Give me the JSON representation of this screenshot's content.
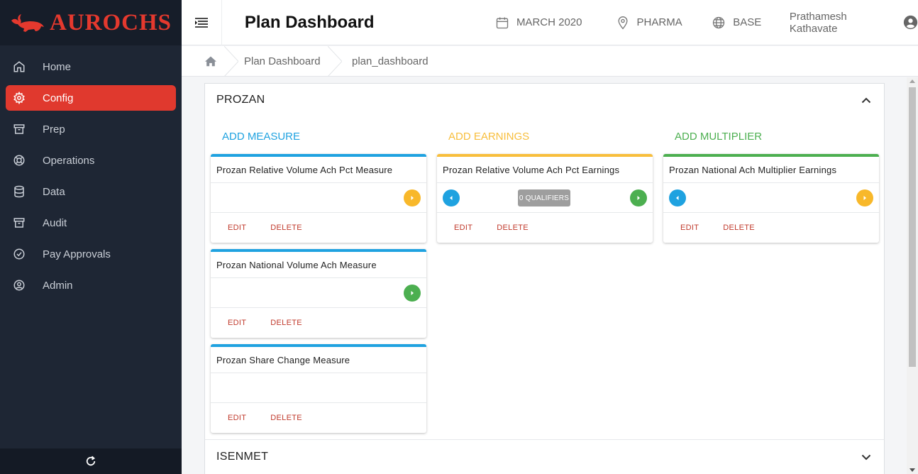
{
  "app": {
    "brand": "AUROCHS",
    "brand_color": "#e0392e"
  },
  "sidebar": {
    "items": [
      {
        "label": "Home",
        "icon": "home-icon",
        "active": false
      },
      {
        "label": "Config",
        "icon": "gear-icon",
        "active": true
      },
      {
        "label": "Prep",
        "icon": "archive-icon",
        "active": false
      },
      {
        "label": "Operations",
        "icon": "lifebuoy-icon",
        "active": false
      },
      {
        "label": "Data",
        "icon": "database-icon",
        "active": false
      },
      {
        "label": "Audit",
        "icon": "archive-icon",
        "active": false
      },
      {
        "label": "Pay Approvals",
        "icon": "check-circle-icon",
        "active": false
      },
      {
        "label": "Admin",
        "icon": "user-circle-icon",
        "active": false
      }
    ],
    "footer_icon": "refresh-icon"
  },
  "header": {
    "title": "Plan Dashboard",
    "period": "MARCH 2020",
    "region": "PHARMA",
    "scenario": "BASE",
    "user": "Prathamesh Kathavate"
  },
  "breadcrumb": {
    "items": [
      "Plan Dashboard",
      "plan_dashboard"
    ]
  },
  "panels": [
    {
      "title": "PROZAN",
      "expanded": true,
      "columns": [
        {
          "add_label": "ADD MEASURE",
          "color": "#1fa2e0",
          "cards": [
            {
              "title": "Prozan Relative Volume Ach Pct Measure",
              "left": null,
              "right": "#f8b82a",
              "badge": null
            },
            {
              "title": "Prozan National Volume Ach Measure",
              "left": null,
              "right": "#4caf50",
              "badge": null
            },
            {
              "title": "Prozan Share Change Measure",
              "left": null,
              "right": null,
              "badge": null
            }
          ]
        },
        {
          "add_label": "ADD EARNINGS",
          "color": "#f8be3c",
          "cards": [
            {
              "title": "Prozan Relative Volume Ach Pct Earnings",
              "left": "#1fa2e0",
              "right": "#4caf50",
              "badge": "0 QUALIFIERS"
            }
          ]
        },
        {
          "add_label": "ADD MULTIPLIER",
          "color": "#4caf50",
          "cards": [
            {
              "title": "Prozan National Ach Multiplier Earnings",
              "left": "#1fa2e0",
              "right": "#f8b82a",
              "badge": null
            }
          ]
        }
      ],
      "edit_label": "EDIT",
      "delete_label": "DELETE"
    },
    {
      "title": "ISENMET",
      "expanded": false
    }
  ]
}
